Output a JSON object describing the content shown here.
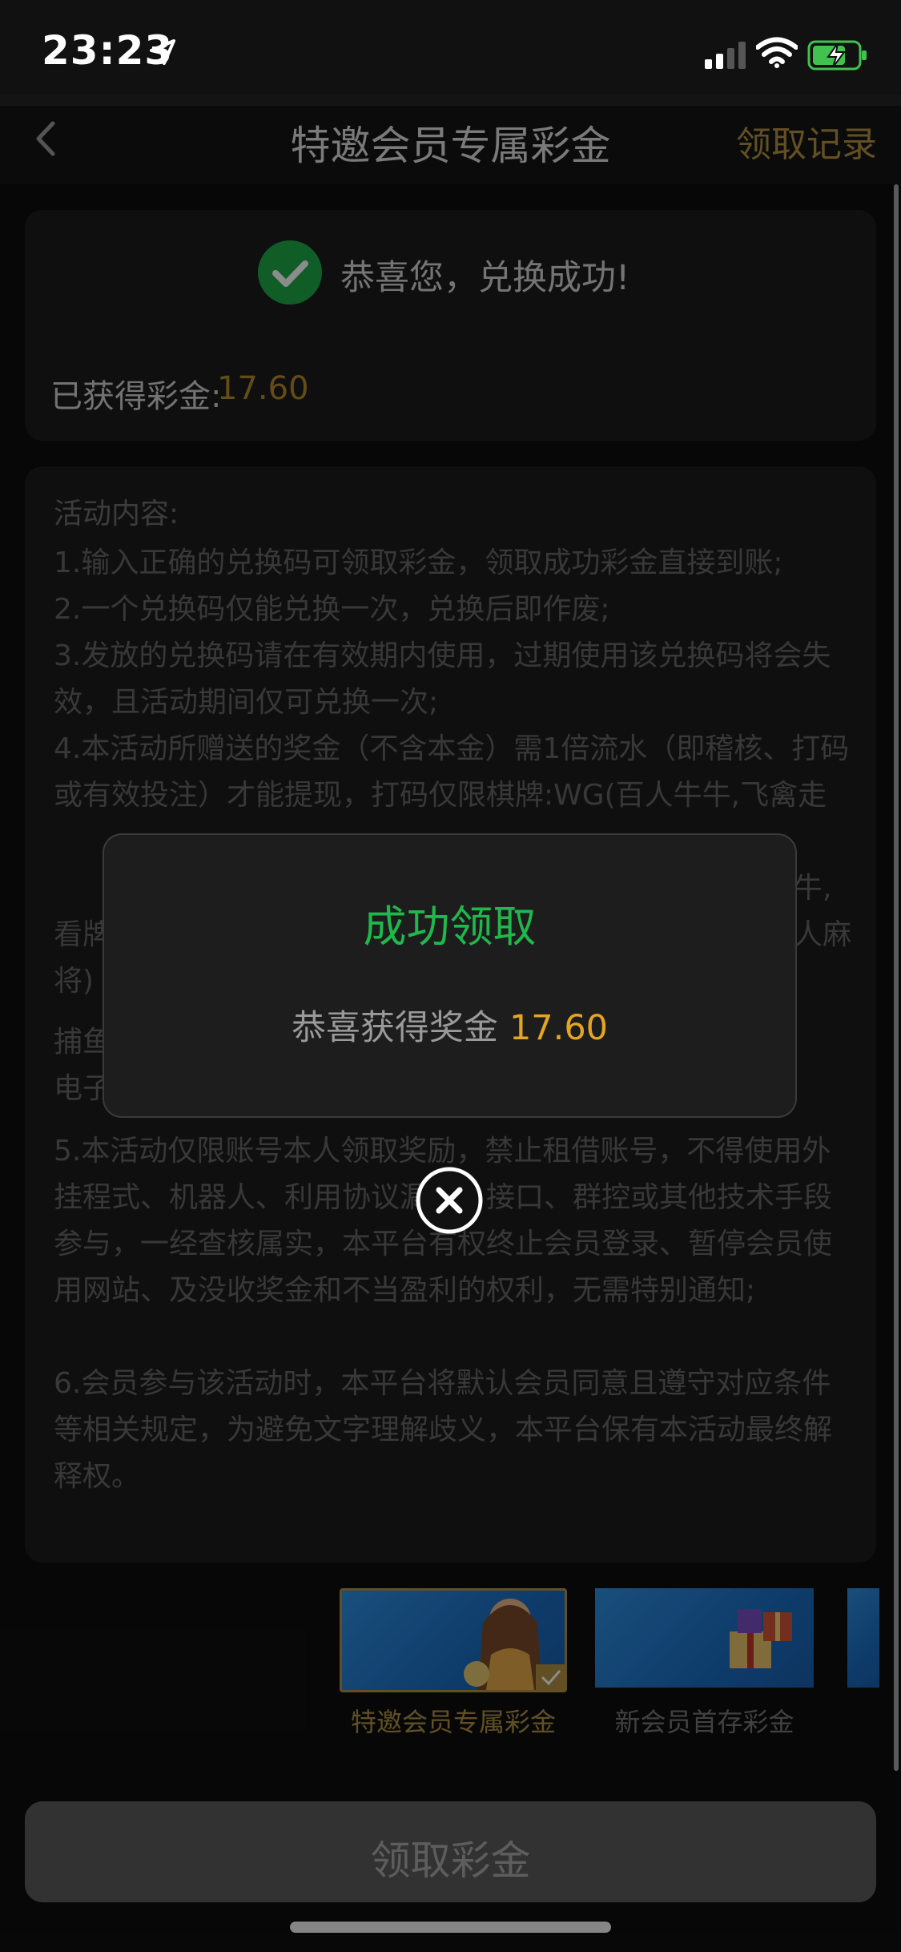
{
  "status": {
    "time": "23:23"
  },
  "nav": {
    "title": "特邀会员专属彩金",
    "right_link": "领取记录"
  },
  "success_card": {
    "message": "恭喜您，兑换成功!",
    "obtained_label": "已获得彩金:",
    "obtained_value": "17.60"
  },
  "rules": {
    "title": "活动内容:",
    "items": [
      "1.输入正确的兑换码可领取彩金，领取成功彩金直接到账;",
      "2.一个兑换码仅能兑换一次，兑换后即作废;",
      "3.发放的兑换码请在有效期内使用，过期使用该兑换码将会失效，且活动期间仅可兑换一次;",
      "4.本活动所赠送的奖金（不含本金）需1倍流水（即稽核、打码或有效投注）才能提现，打码仅限棋牌:WG(百人牛牛,飞禽走兽",
      "牛,",
      "看牌",
      "人麻",
      "将)",
      "捕鱼",
      "电子",
      "5.本活动仅限账号本人领取奖励，禁止租借账号，不得使用外挂程式、机器人、利用协议漏洞、接口、群控或其他技术手段参与，一经查核属实，本平台有权终止会员登录、暂停会员使用网站、及没收奖金和不当盈利的权利，无需特别通知;",
      "6.会员参与该活动时，本平台将默认会员同意且遵守对应条件等相关规定，为避免文字理解歧义，本平台保有本活动最终解释权。"
    ]
  },
  "banners": [
    {
      "label": "特邀会员专属彩金",
      "selected": true
    },
    {
      "label": "新会员首存彩金",
      "selected": false
    }
  ],
  "claim_button": {
    "label": "领取彩金"
  },
  "modal": {
    "title": "成功领取",
    "body_label": "恭喜获得奖金",
    "amount": "17.60"
  },
  "colors": {
    "accent_gold": "#b39243",
    "success_green": "#1fb84a",
    "amount_orange": "#e4a520"
  },
  "icons": [
    "location-arrow-icon",
    "signal-icon",
    "wifi-icon",
    "battery-charging-icon",
    "back-chevron-icon",
    "check-icon",
    "close-icon"
  ]
}
